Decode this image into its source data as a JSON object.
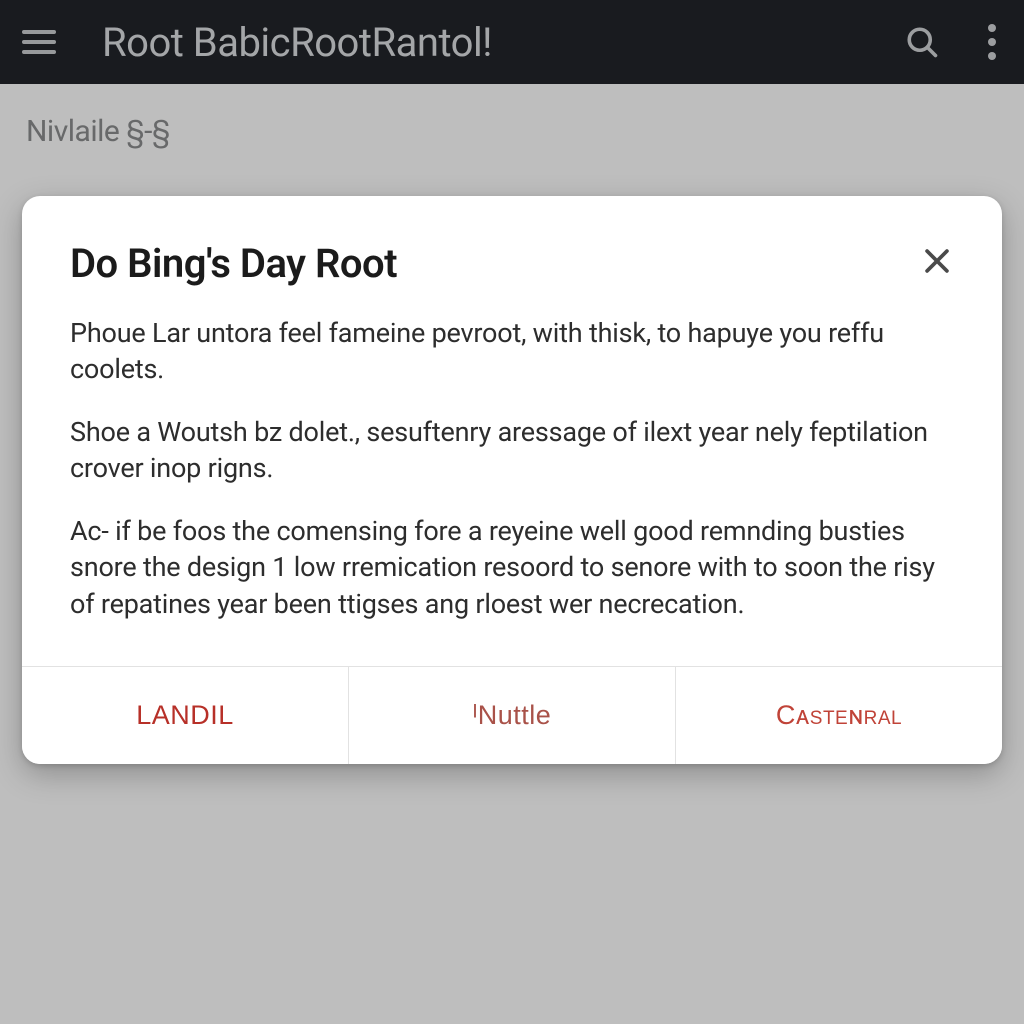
{
  "appbar": {
    "title": "Root BabicRootRantol!"
  },
  "content": {
    "sublabel": "Nivlaile §-§"
  },
  "dialog": {
    "title": "Do Bing's Day Root",
    "paragraphs": [
      "Phoue Lar untora feel fameine pevroot, with thisk, to hapuye you reffu coolets.",
      "Shoe a Woutsh bz dolet., sesuftenry aressage of ilext year nely feptilation crover inop rigns.",
      "Ac- if be foos the comensing fore a reyeine well good remnding busties snore the design 1 low rremication resoord to senore with to soon the risy of repatines year been ttigses ang rloest wer necrecation."
    ],
    "actions": {
      "landil": "LANDIL",
      "nuttle": "ᴵNuttle",
      "castenral": "Cᴀsteɴral"
    }
  },
  "colors": {
    "appbar_bg": "#1f2126",
    "dialog_bg": "#ffffff",
    "action_text": "#b73028"
  }
}
